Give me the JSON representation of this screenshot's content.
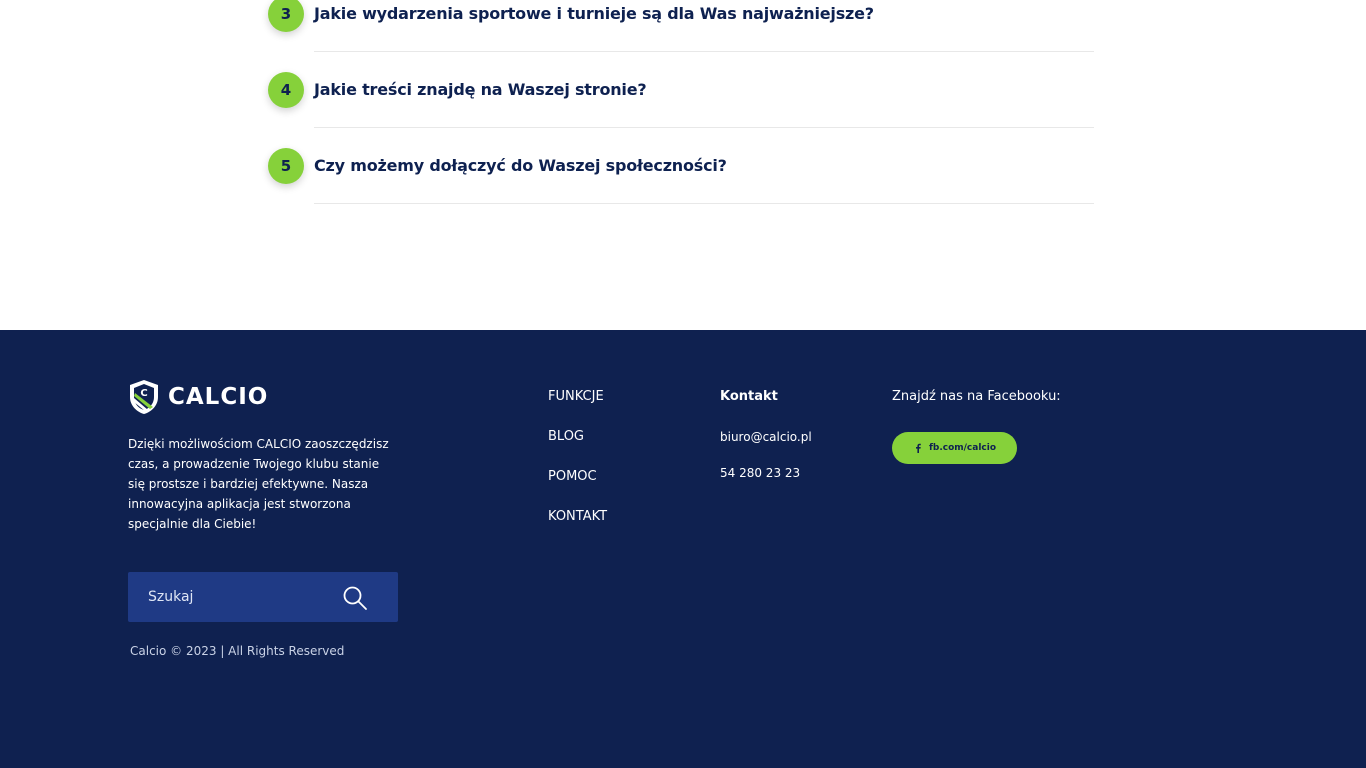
{
  "faq": {
    "items": [
      {
        "number": "3",
        "question": "Jakie wydarzenia sportowe i turnieje są dla Was najważniejsze?"
      },
      {
        "number": "4",
        "question": "Jakie treści znajdę na Waszej stronie?"
      },
      {
        "number": "5",
        "question": "Czy możemy dołączyć do Waszej społeczności?"
      }
    ]
  },
  "footer": {
    "logo_text": "CALCIO",
    "about": "Dzięki możliwościom CALCIO zaoszczędzisz czas, a prowadzenie Twojego klubu stanie się prostsze i bardziej efektywne. Nasza innowacyjna aplikacja jest stworzona specjalnie dla Ciebie!",
    "search": {
      "placeholder": "Szukaj",
      "icon": "search-icon"
    },
    "copyright": "Calcio © 2023 | All Rights Reserved",
    "nav": [
      "FUNKCJE",
      "BLOG",
      "POMOC",
      "KONTAKT"
    ],
    "contact": {
      "title": "Kontakt",
      "email": "biuro@calcio.pl",
      "phone": "54 280 23 23"
    },
    "facebook": {
      "title": "Znajdź nas na Facebooku:",
      "button_label": "fb.com/calcio",
      "icon": "facebook-icon"
    }
  },
  "colors": {
    "navy": "#0f2150",
    "accent_green": "#86d13a",
    "search_bg": "#1f3a85"
  }
}
